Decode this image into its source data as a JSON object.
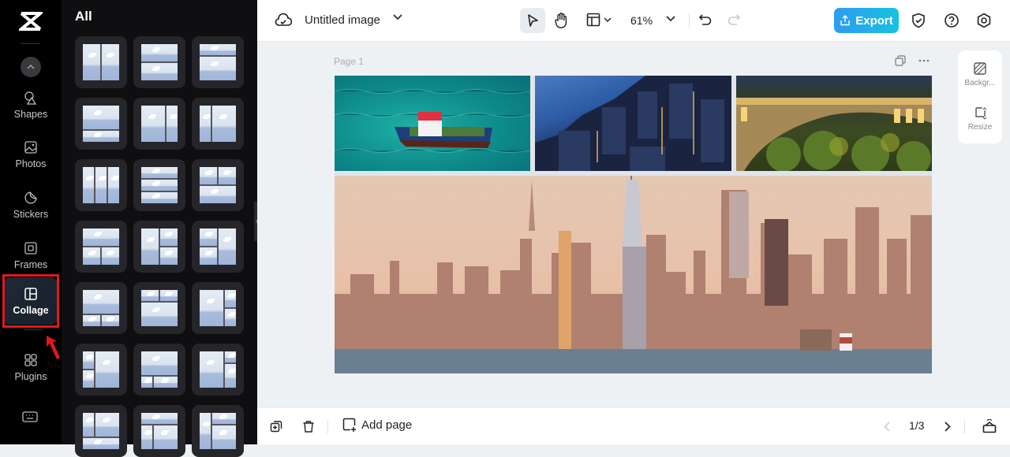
{
  "rail": {
    "items": [
      {
        "label": "Shapes",
        "icon": "shapes-icon"
      },
      {
        "label": "Photos",
        "icon": "photo-icon"
      },
      {
        "label": "Stickers",
        "icon": "sticker-icon"
      },
      {
        "label": "Frames",
        "icon": "frame-icon"
      },
      {
        "label": "Collage",
        "icon": "collage-icon",
        "active": true
      },
      {
        "label": "Plugins",
        "icon": "plugins-icon"
      }
    ],
    "highlight_color": "#e3161e"
  },
  "panel": {
    "title": "All",
    "layout_count_visible": 21
  },
  "topbar": {
    "doc_title": "Untitled image",
    "zoom": "61%",
    "export_label": "Export",
    "export_color": "#16c3e0"
  },
  "canvas": {
    "page_label": "Page 1",
    "images": [
      {
        "name": "tugboat-on-turquoise-sea"
      },
      {
        "name": "aerial-city-at-dusk"
      },
      {
        "name": "illuminated-arch-bridge"
      },
      {
        "name": "new-york-skyline-sunset"
      }
    ]
  },
  "side_tools": {
    "background_label": "Backgr...",
    "resize_label": "Resize"
  },
  "bottombar": {
    "add_page_label": "Add page",
    "pager": "1/3"
  }
}
